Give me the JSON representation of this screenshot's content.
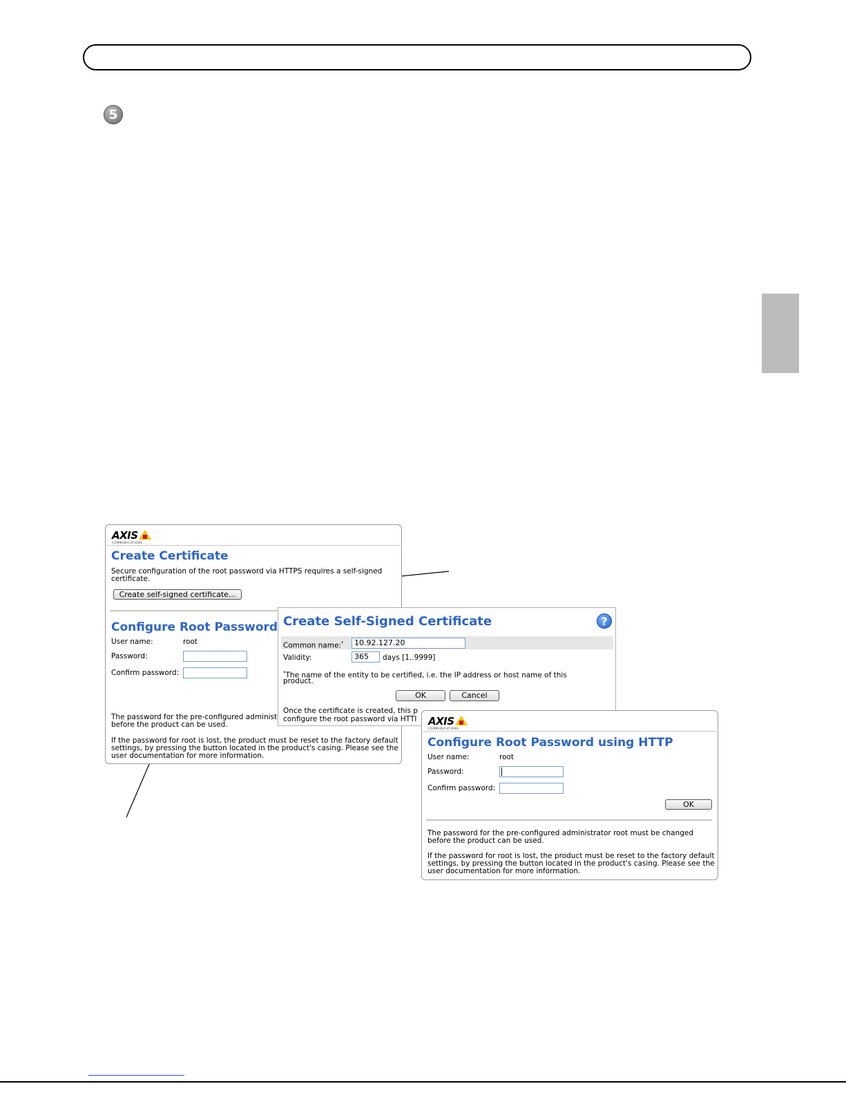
{
  "page": {
    "step_number": "5"
  },
  "create_certificate": {
    "logo_text": "AXIS",
    "logo_sub": "COMMUNICATIONS",
    "title": "Create Certificate",
    "description_line1": "Secure configuration of the root password via HTTPS requires a self-signed",
    "description_line2": "certificate.",
    "create_button": "Create self-signed certificate...",
    "config_title": "Configure Root Password",
    "username_label": "User name:",
    "username_value": "root",
    "password_label": "Password:",
    "confirm_label": "Confirm password:",
    "note1_line1": "The password for the pre-configured administra",
    "note1_line2": "before the product can be used.",
    "note2_line1": "If the password for root is lost, the product must be reset to the factory default",
    "note2_line2": "settings, by pressing the button located in the product's casing. Please see the",
    "note2_line3": "user documentation for more information."
  },
  "self_signed_dialog": {
    "title": "Create Self-Signed Certificate",
    "help_icon": "?",
    "common_name_label": "Common name:",
    "required_mark": "*",
    "common_name_value": "10.92.127.20",
    "validity_label": "Validity:",
    "validity_value": "365",
    "validity_unit": "days [1..9999]",
    "footnote_line1": "The name of the entity to be certified, i.e. the IP address or host name of this",
    "footnote_line2": "product.",
    "ok_button": "OK",
    "cancel_button": "Cancel",
    "info_line1": "Once the certificate is created, this p",
    "info_line2": "configure the root password via HTTI"
  },
  "http_dialog": {
    "logo_text": "AXIS",
    "logo_sub": "COMMUNICATIONS",
    "title": "Configure Root Password using HTTP",
    "username_label": "User name:",
    "username_value": "root",
    "password_label": "Password:",
    "confirm_label": "Confirm password:",
    "ok_button": "OK",
    "note1_line1": "The password for the pre-configured administrator root must be changed",
    "note1_line2": "before the product can be used.",
    "note2_line1": "If the password for root is lost, the product must be reset to the factory default",
    "note2_line2": "settings, by pressing the button located in the product's casing. Please see the",
    "note2_line3": "user documentation for more information."
  },
  "colors": {
    "heading_blue": "#2d64c8",
    "side_tab": "#bcbcbc"
  }
}
